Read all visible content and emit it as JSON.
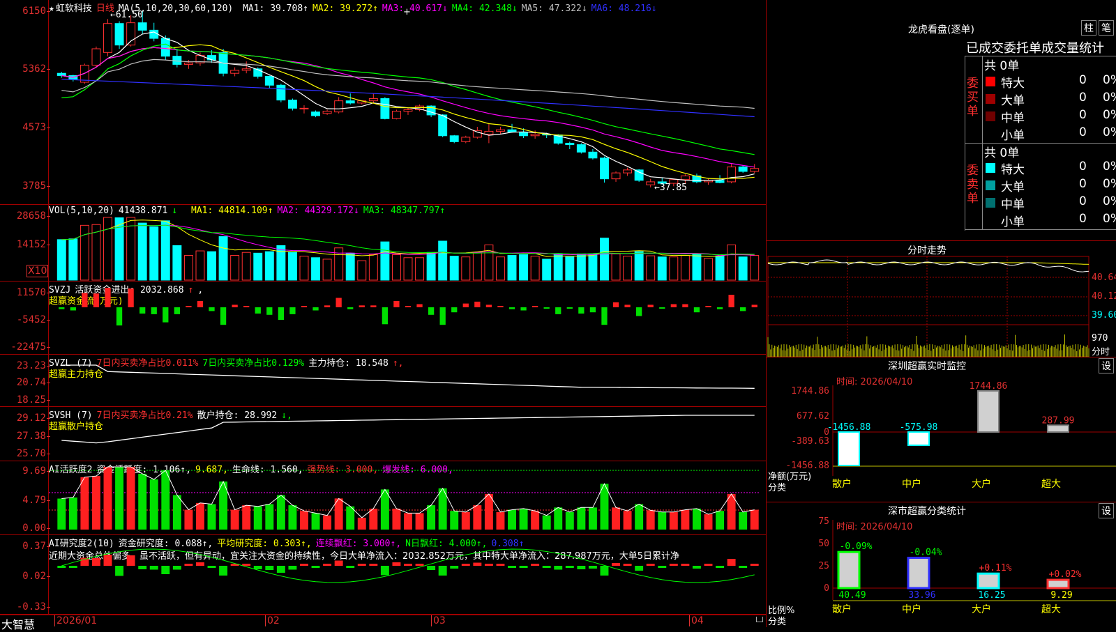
{
  "stock": {
    "name": "虹软科技",
    "period": "日线"
  },
  "main": {
    "ma_label": "MA(5,10,20,30,60,120)",
    "ma": [
      {
        "label": "MA1: 39.708",
        "arrow": "↑",
        "color": "#ffffff"
      },
      {
        "label": "MA2: 39.272",
        "arrow": "↑",
        "color": "#ffff00"
      },
      {
        "label": "MA3: 40.617",
        "arrow": "↓",
        "color": "#ff00ff"
      },
      {
        "label": "MA4: 42.348",
        "arrow": "↓",
        "color": "#00ff00"
      },
      {
        "label": "MA5: 47.322",
        "arrow": "↓",
        "color": "#c0c0c0"
      },
      {
        "label": "MA6: 48.216",
        "arrow": "↓",
        "color": "#3030ff"
      }
    ],
    "y_ticks": [
      "6150",
      "5362",
      "4573",
      "3785"
    ],
    "high_label": "61.50",
    "low_label": "37.85"
  },
  "vol": {
    "header": "VOL(5,10,20)",
    "value": "41438.871",
    "arrow": "↓",
    "mas": [
      {
        "label": "MA1: 44814.109",
        "arrow": "↑",
        "color": "#ffff00"
      },
      {
        "label": "MA2: 44329.172",
        "arrow": "↓",
        "color": "#ff00ff"
      },
      {
        "label": "MA3: 48347.797",
        "arrow": "↑",
        "color": "#00ff00"
      }
    ],
    "y_ticks": [
      "28658",
      "14152"
    ],
    "unit": "X10"
  },
  "svzj": {
    "header": "SVZJ",
    "item": "活跃资金进出: 2032.868",
    "arrow": "↑",
    "sub": "超赢资金流(万元)",
    "y_ticks": [
      "11570",
      "-5452",
      "-22475"
    ]
  },
  "svzl": {
    "header": "SVZL (7)",
    "item1": "7日内买卖净占比0.011%",
    "item2": "7日内买卖净占比0.129%",
    "item3": "主力持仓: 18.548",
    "arrow": "↑,",
    "sub": "超赢主力持仓",
    "y_ticks": [
      "23.23",
      "20.74",
      "18.25"
    ]
  },
  "svsh": {
    "header": "SVSH (7)",
    "item1": "7日内买卖净占比0.21%",
    "item2": "散户持仓: 28.992",
    "arrow": "↓,",
    "sub": "超赢散户持仓",
    "y_ticks": [
      "29.12",
      "27.38",
      "25.70"
    ]
  },
  "ai1": {
    "header": "AI活跃度2",
    "items": [
      {
        "label": "资金活跃度: 1.106",
        "arrow": "↑,",
        "color": "#ffffff"
      },
      {
        "label": "9.687,",
        "arrow": "",
        "color": "#ffff00"
      },
      {
        "label": "生命线: 1.560,",
        "arrow": "",
        "color": "#ffffff"
      },
      {
        "label": "强势线: 3.000,",
        "arrow": "",
        "color": "#ff3030"
      },
      {
        "label": "爆发线: 6.000,",
        "arrow": "",
        "color": "#ff00ff"
      }
    ],
    "y_ticks": [
      "9.69",
      "4.79",
      "0.00"
    ]
  },
  "ai2": {
    "header": "AI研究度2(10)",
    "items": [
      {
        "label": "资金研究度: 0.088",
        "arrow": "↑,",
        "color": "#ffffff"
      },
      {
        "label": "平均研究度: 0.303",
        "arrow": "↑,",
        "color": "#ffff00"
      },
      {
        "label": "连续飘红: 3.000",
        "arrow": "↑,",
        "color": "#ff00ff"
      },
      {
        "label": "N日飘红: 4.000",
        "arrow": "↑,",
        "color": "#00ff00"
      },
      {
        "label": "0.308",
        "arrow": "↑",
        "color": "#3030ff"
      }
    ],
    "note": "近期大资金总体偏多，虽不活跃，但有异动，宜关注大资金的持续性，今日大单净流入：2032.852万元，其中特大单净流入：287.987万元，大单5日累计净",
    "y_ticks": [
      "0.37",
      "0.02",
      "-0.33"
    ]
  },
  "footer": {
    "brand": "大智慧",
    "dates": [
      "2026/01",
      "02",
      "03",
      "04"
    ]
  },
  "dragon": {
    "title": "龙虎看盘(逐单)",
    "btn1": "柱",
    "btn2": "笔",
    "subtitle": "已成交委托单成交量统计",
    "buy_label": "委买单",
    "sell_label": "委卖单",
    "buy_total": "共 0单",
    "sell_total": "共 0单",
    "buy_rows": [
      {
        "name": "特大",
        "count": "0",
        "pct": "0%",
        "color": "#ff0000"
      },
      {
        "name": "大单",
        "count": "0",
        "pct": "0%",
        "color": "#a00000"
      },
      {
        "name": "中单",
        "count": "0",
        "pct": "0%",
        "color": "#700000"
      },
      {
        "name": "小单",
        "count": "0",
        "pct": "0%",
        "color": ""
      }
    ],
    "sell_rows": [
      {
        "name": "特大",
        "count": "0",
        "pct": "0%",
        "color": "#00ffff"
      },
      {
        "name": "大单",
        "count": "0",
        "pct": "0%",
        "color": "#00a0a0"
      },
      {
        "name": "中单",
        "count": "0",
        "pct": "0%",
        "color": "#007070"
      },
      {
        "name": "小单",
        "count": "0",
        "pct": "0%",
        "color": ""
      }
    ]
  },
  "intraday": {
    "title": "分时走势",
    "y_ticks": [
      "40.64",
      "40.12",
      "39.60"
    ],
    "vol_tick": "970",
    "unit": "分时"
  },
  "sz_monitor": {
    "title": "深圳超赢实时监控",
    "settings": "设",
    "time": "时间: 2026/04/10",
    "y_ticks": [
      "1744.86",
      "677.62",
      "0",
      "-389.63",
      "-1456.88"
    ],
    "axis_label": "净额(万元)",
    "cat_label": "分类",
    "cats": [
      "散户",
      "中户",
      "大户",
      "超大"
    ],
    "values": [
      -1456.88,
      -575.98,
      1744.86,
      287.99
    ],
    "value_labels": [
      "-1456.88",
      "-575.98",
      "1744.86",
      "287.99"
    ]
  },
  "sz_class": {
    "title": "深市超赢分类统计",
    "settings": "设",
    "time": "时间: 2026/04/10",
    "y_ticks": [
      "75",
      "50",
      "25",
      "0"
    ],
    "axis_label": "比例%",
    "cat_label": "分类",
    "cats": [
      "散户",
      "中户",
      "大户",
      "超大"
    ],
    "values": [
      40.49,
      33.96,
      16.25,
      9.29
    ],
    "value_labels": [
      "40.49",
      "33.96",
      "16.25",
      "9.29"
    ],
    "change_labels": [
      "-0.09%",
      "-0.04%",
      "+0.11%",
      "+0.02%"
    ]
  },
  "chart_data": {
    "type": "candlestick",
    "title": "虹软科技 日线",
    "candles": [
      [
        53.2,
        53.4,
        52.6,
        52.9
      ],
      [
        52.9,
        53.0,
        52.1,
        52.4
      ],
      [
        52.0,
        54.5,
        51.8,
        54.3
      ],
      [
        54.3,
        56.8,
        54.0,
        56.5
      ],
      [
        56.0,
        60.5,
        55.5,
        59.9
      ],
      [
        59.9,
        60.2,
        56.5,
        57.0
      ],
      [
        57.0,
        61.0,
        56.8,
        60.0
      ],
      [
        60.0,
        61.5,
        58.5,
        59.0
      ],
      [
        59.0,
        60.0,
        57.5,
        57.9
      ],
      [
        57.9,
        58.3,
        55.0,
        55.5
      ],
      [
        55.5,
        56.5,
        54.0,
        54.4
      ],
      [
        54.4,
        55.0,
        53.8,
        54.6
      ],
      [
        54.6,
        56.0,
        54.2,
        55.6
      ],
      [
        55.6,
        56.3,
        54.6,
        55.0
      ],
      [
        56.0,
        56.5,
        52.8,
        53.2
      ],
      [
        53.2,
        54.0,
        52.8,
        53.6
      ],
      [
        53.6,
        54.8,
        53.2,
        53.8
      ],
      [
        53.8,
        54.0,
        52.5,
        52.8
      ],
      [
        52.8,
        52.9,
        51.2,
        51.6
      ],
      [
        51.6,
        51.8,
        49.3,
        49.6
      ],
      [
        49.6,
        49.8,
        48.2,
        48.5
      ],
      [
        48.5,
        48.9,
        47.8,
        48.5
      ],
      [
        48.0,
        48.2,
        47.3,
        47.5
      ],
      [
        47.8,
        48.3,
        47.6,
        48.1
      ],
      [
        48.0,
        50.0,
        47.8,
        49.5
      ],
      [
        49.5,
        50.5,
        49.0,
        49.2
      ],
      [
        49.2,
        49.5,
        49.0,
        49.5
      ],
      [
        49.5,
        50.5,
        49.2,
        49.8
      ],
      [
        49.8,
        50.0,
        47.0,
        47.1
      ],
      [
        47.1,
        48.3,
        47.0,
        48.1
      ],
      [
        48.1,
        48.5,
        47.6,
        48.3
      ],
      [
        48.3,
        49.0,
        48.1,
        48.8
      ],
      [
        48.8,
        48.9,
        47.3,
        47.6
      ],
      [
        47.6,
        47.7,
        44.6,
        44.8
      ],
      [
        44.8,
        44.9,
        43.8,
        44.0
      ],
      [
        44.0,
        44.8,
        43.8,
        44.6
      ],
      [
        44.6,
        46.0,
        44.4,
        45.5
      ],
      [
        45.0,
        46.4,
        43.8,
        45.4
      ],
      [
        45.4,
        46.0,
        45.0,
        45.6
      ],
      [
        45.6,
        46.4,
        45.2,
        45.3
      ],
      [
        45.3,
        45.8,
        44.5,
        44.8
      ],
      [
        44.8,
        45.5,
        44.4,
        45.0
      ],
      [
        45.0,
        45.2,
        44.5,
        44.9
      ],
      [
        44.9,
        45.0,
        43.6,
        43.8
      ],
      [
        43.8,
        44.0,
        43.0,
        43.6
      ],
      [
        43.6,
        43.8,
        42.4,
        42.6
      ],
      [
        42.6,
        43.0,
        41.6,
        41.8
      ],
      [
        41.8,
        42.0,
        38.5,
        39.0
      ],
      [
        39.0,
        40.0,
        38.6,
        39.8
      ],
      [
        39.8,
        40.5,
        39.4,
        40.2
      ],
      [
        40.2,
        40.3,
        38.6,
        38.8
      ],
      [
        38.2,
        39.0,
        37.85,
        38.6
      ],
      [
        38.6,
        39.2,
        38.2,
        38.4
      ],
      [
        38.4,
        39.0,
        38.0,
        38.9
      ],
      [
        38.9,
        39.6,
        38.4,
        39.4
      ],
      [
        39.4,
        39.7,
        38.4,
        38.6
      ],
      [
        38.6,
        39.0,
        38.2,
        38.8
      ],
      [
        38.8,
        39.5,
        38.4,
        38.5
      ],
      [
        38.6,
        41.0,
        38.4,
        40.6
      ],
      [
        40.6,
        40.8,
        39.8,
        40.0
      ],
      [
        40.0,
        41.0,
        39.8,
        40.4
      ]
    ],
    "ylim": [
      37.0,
      62.5
    ]
  }
}
